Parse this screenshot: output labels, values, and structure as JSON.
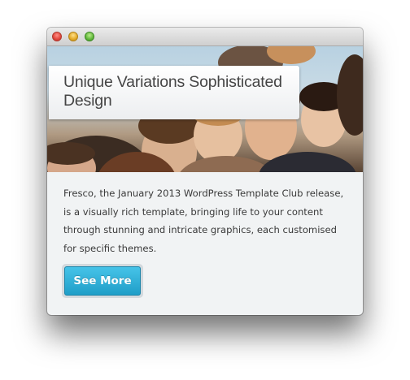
{
  "window": {
    "traffic_lights": [
      "close",
      "minimize",
      "zoom"
    ]
  },
  "hero": {
    "image_description_icon": "people-group-photo",
    "headline": "Unique Variations Sophisticated Design"
  },
  "content": {
    "description": "Fresco, the January 2013 WordPress Template Club release, is a visually rich template, bringing life to your content through stunning and intricate graphics, each customised for specific themes."
  },
  "cta": {
    "label": "See More",
    "color": "#2aaed7"
  }
}
